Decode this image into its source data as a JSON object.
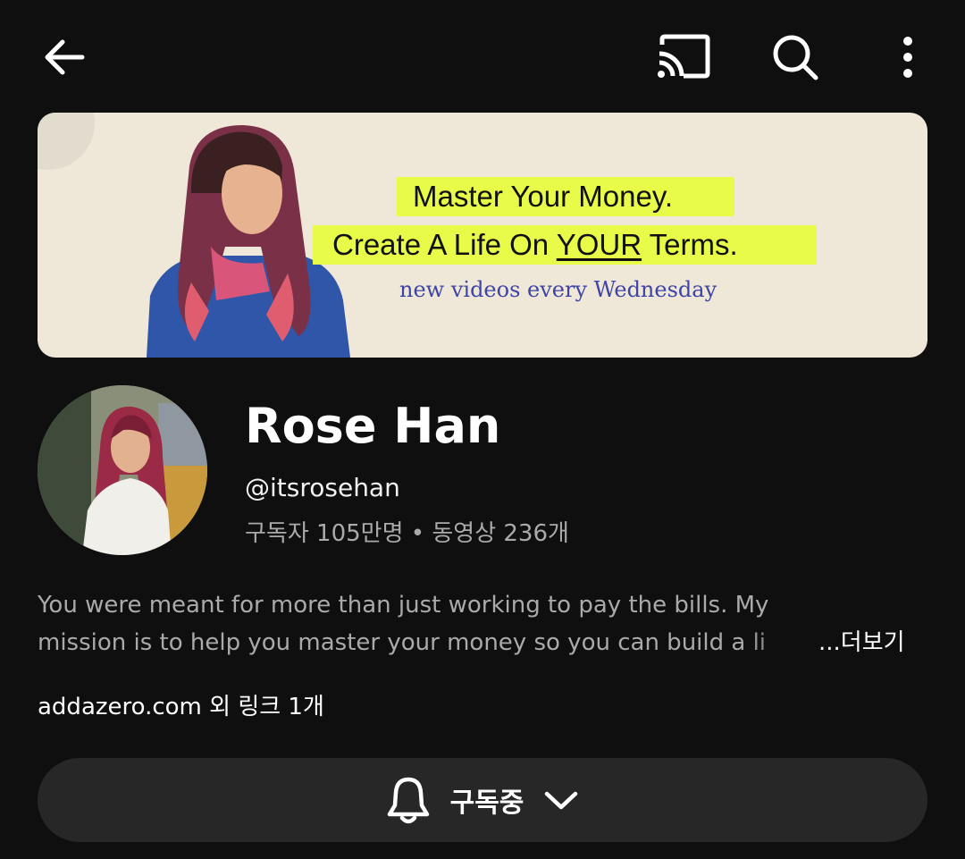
{
  "topbar": {
    "icons": [
      "back-arrow-icon",
      "cast-icon",
      "search-icon",
      "more-vert-icon"
    ]
  },
  "banner": {
    "line1": "Master Your Money.",
    "line2_pre": "Create A Life On ",
    "line2_em": "YOUR",
    "line2_post": " Terms.",
    "line3": "new videos every Wednesday",
    "highlight_color": "#e7fb48",
    "background_color": "#efe8d8"
  },
  "channel": {
    "name": "Rose Han",
    "handle": "@itsrosehan",
    "stats": "구독자 105만명 • 동영상 236개"
  },
  "description": {
    "line1": "You were meant for more than just working to pay the bills. My",
    "line2": "mission is to help you master your money so you can build a li",
    "more": "...더보기"
  },
  "links": {
    "text": "addazero.com 외 링크 1개"
  },
  "subscribe": {
    "label": "구독중",
    "icons": [
      "bell-icon",
      "chevron-down-icon"
    ]
  },
  "colors": {
    "background": "#0f0f0f",
    "secondary_text": "#aaaaaa",
    "button_bg": "#272727"
  }
}
